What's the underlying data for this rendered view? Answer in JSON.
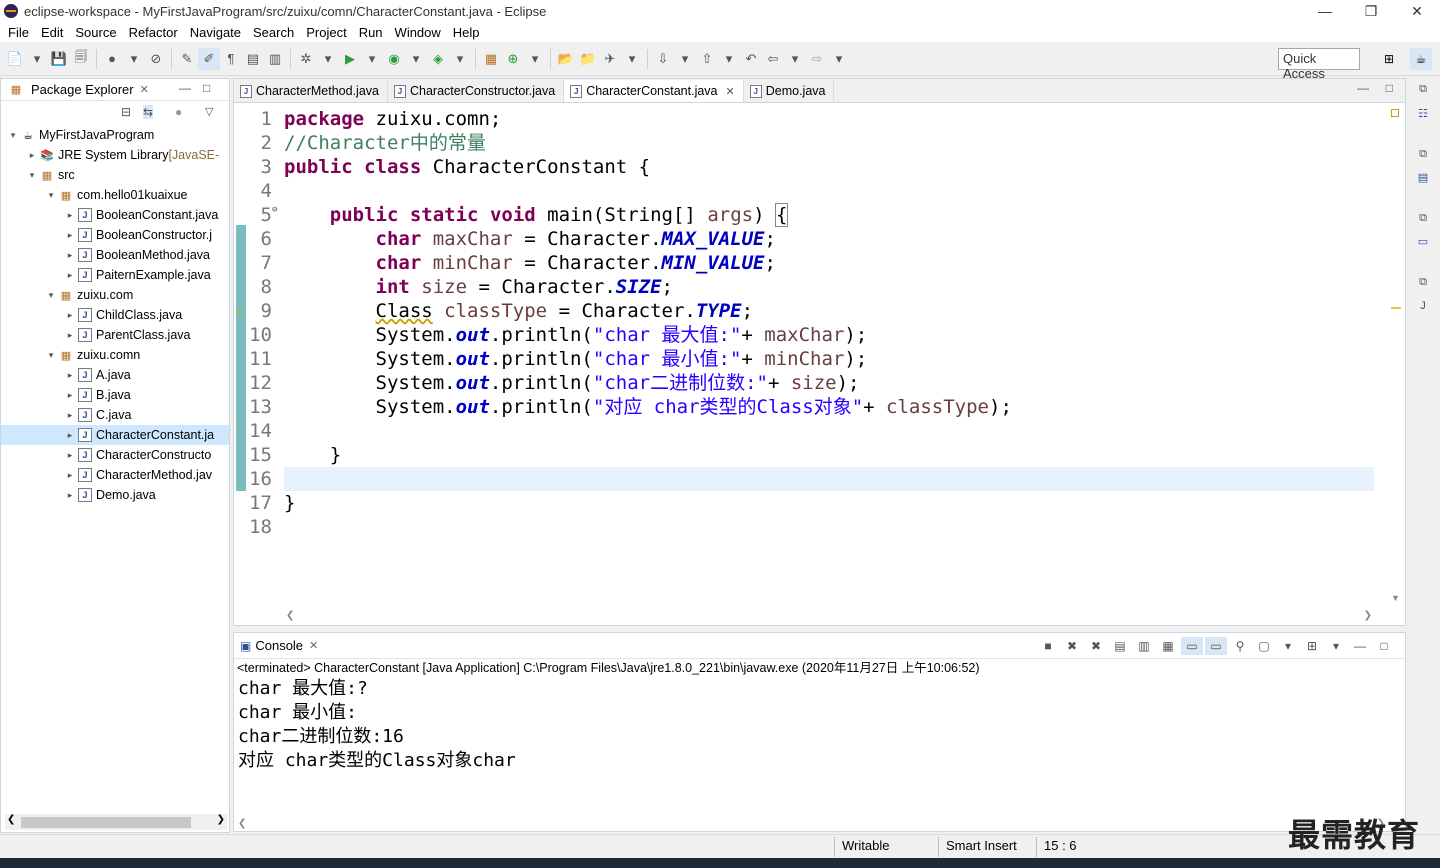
{
  "window": {
    "title": "eclipse-workspace - MyFirstJavaProgram/src/zuixu/comn/CharacterConstant.java - Eclipse",
    "min": "—",
    "max": "❐",
    "close": "✕"
  },
  "menu": [
    "File",
    "Edit",
    "Source",
    "Refactor",
    "Navigate",
    "Search",
    "Project",
    "Run",
    "Window",
    "Help"
  ],
  "toolbar": {
    "quick_access": "Quick Access"
  },
  "package_explorer": {
    "title": "Package Explorer",
    "tree": [
      {
        "label": "MyFirstJavaProgram",
        "depth": 0,
        "arrow": "▾",
        "icon": "project"
      },
      {
        "label": "JRE System Library",
        "extra": " [JavaSE-",
        "depth": 1,
        "arrow": "▸",
        "icon": "library"
      },
      {
        "label": "src",
        "depth": 1,
        "arrow": "▾",
        "icon": "folder"
      },
      {
        "label": "com.hello01kuaixue",
        "depth": 2,
        "arrow": "▾",
        "icon": "package"
      },
      {
        "label": "BooleanConstant.java",
        "depth": 3,
        "arrow": "▸",
        "icon": "file"
      },
      {
        "label": "BooleanConstructor.j",
        "depth": 3,
        "arrow": "▸",
        "icon": "file"
      },
      {
        "label": "BooleanMethod.java",
        "depth": 3,
        "arrow": "▸",
        "icon": "file"
      },
      {
        "label": "PaiternExample.java",
        "depth": 3,
        "arrow": "▸",
        "icon": "file"
      },
      {
        "label": "zuixu.com",
        "depth": 2,
        "arrow": "▾",
        "icon": "package"
      },
      {
        "label": "ChildClass.java",
        "depth": 3,
        "arrow": "▸",
        "icon": "file"
      },
      {
        "label": "ParentClass.java",
        "depth": 3,
        "arrow": "▸",
        "icon": "file"
      },
      {
        "label": "zuixu.comn",
        "depth": 2,
        "arrow": "▾",
        "icon": "package"
      },
      {
        "label": "A.java",
        "depth": 3,
        "arrow": "▸",
        "icon": "file"
      },
      {
        "label": "B.java",
        "depth": 3,
        "arrow": "▸",
        "icon": "file"
      },
      {
        "label": "C.java",
        "depth": 3,
        "arrow": "▸",
        "icon": "file"
      },
      {
        "label": "CharacterConstant.ja",
        "depth": 3,
        "arrow": "▸",
        "icon": "file",
        "selected": true
      },
      {
        "label": "CharacterConstructo",
        "depth": 3,
        "arrow": "▸",
        "icon": "file"
      },
      {
        "label": "CharacterMethod.jav",
        "depth": 3,
        "arrow": "▸",
        "icon": "file"
      },
      {
        "label": "Demo.java",
        "depth": 3,
        "arrow": "▸",
        "icon": "file"
      }
    ]
  },
  "editor": {
    "tabs": [
      {
        "label": "CharacterMethod.java",
        "active": false
      },
      {
        "label": "CharacterConstructor.java",
        "active": false
      },
      {
        "label": "CharacterConstant.java",
        "active": true,
        "close": "✕"
      },
      {
        "label": "Demo.java",
        "active": false
      }
    ],
    "line_numbers": [
      "1",
      "2",
      "3",
      "4",
      "5",
      "6",
      "7",
      "8",
      "9",
      "10",
      "11",
      "12",
      "13",
      "14",
      "15",
      "16",
      "17",
      "18"
    ]
  },
  "console": {
    "title": "Console",
    "description": "<terminated> CharacterConstant [Java Application] C:\\Program Files\\Java\\jre1.8.0_221\\bin\\javaw.exe (2020年11月27日 上午10:06:52)",
    "output": [
      "char 最大值:?",
      "char 最小值:",
      "char二进制位数:16",
      "对应 char类型的Class对象char"
    ]
  },
  "status": {
    "writable": "Writable",
    "insert_mode": "Smart Insert",
    "position": "15 : 6"
  },
  "watermark": "最需教育"
}
